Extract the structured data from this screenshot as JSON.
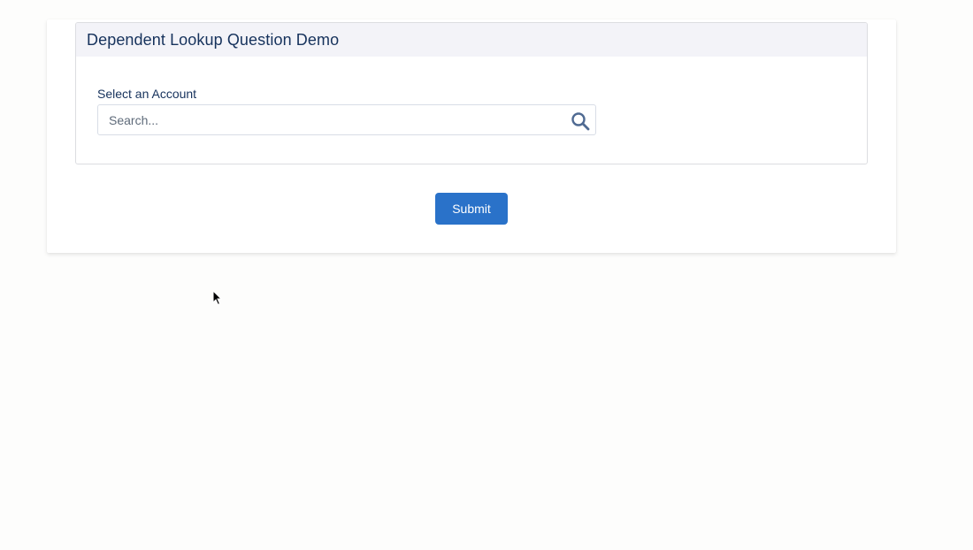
{
  "form": {
    "title": "Dependent Lookup Question Demo",
    "field_label": "Select an Account",
    "search": {
      "placeholder": "Search...",
      "value": "",
      "icon": "search-icon"
    },
    "submit_label": "Submit"
  },
  "colors": {
    "accent": "#2a72c9",
    "header_bg": "#f3f3f8",
    "text": "#16325c"
  }
}
